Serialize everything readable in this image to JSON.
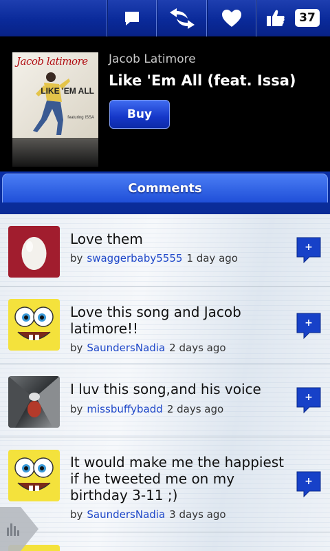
{
  "toolbar": {
    "like_count": "37"
  },
  "song": {
    "artist": "Jacob Latimore",
    "title": "Like 'Em All (feat. Issa)",
    "buy_label": "Buy",
    "cover": {
      "line1": "Jacob latimore",
      "line2": "LIKE 'EM ALL",
      "line3": "featuring ISSA"
    }
  },
  "comments": {
    "header": "Comments",
    "by_label": "by",
    "items": [
      {
        "text": "Love them",
        "user": "swaggerbaby5555",
        "time": "1 day ago",
        "avatar": "egg"
      },
      {
        "text": "Love this song and Jacob latimore!!",
        "user": "SaundersNadia",
        "time": "2 days ago",
        "avatar": "spongebob"
      },
      {
        "text": "I luv this song,and his voice",
        "user": "missbuffybadd",
        "time": "2 days ago",
        "avatar": "photo"
      },
      {
        "text": "It would make me the happiest if he tweeted me on my birthday 3-11 ;)",
        "user": "SaundersNadia",
        "time": "3 days ago",
        "avatar": "spongebob"
      }
    ]
  },
  "colors": {
    "accent_blue": "#0a2b96",
    "link_blue": "#1f48c9"
  }
}
